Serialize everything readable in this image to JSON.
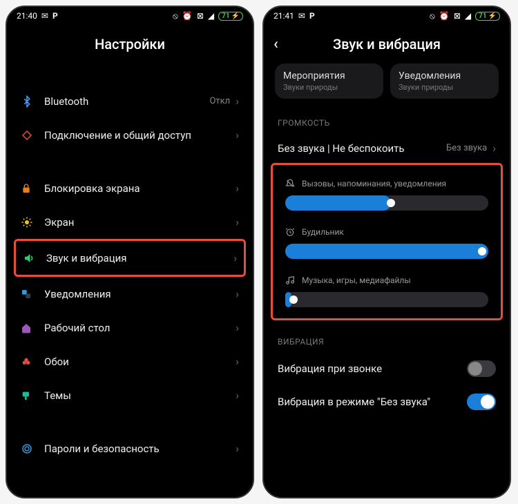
{
  "screen1": {
    "time": "21:40",
    "battery": "71",
    "header": "Настройки",
    "items": {
      "bluetooth": {
        "label": "Bluetooth",
        "value": "Откл"
      },
      "share": {
        "label": "Подключение и общий доступ"
      },
      "lock": {
        "label": "Блокировка экрана"
      },
      "display": {
        "label": "Экран"
      },
      "sound": {
        "label": "Звук и вибрация"
      },
      "notif": {
        "label": "Уведомления"
      },
      "home": {
        "label": "Рабочий стол"
      },
      "wallpaper": {
        "label": "Обои"
      },
      "themes": {
        "label": "Темы"
      },
      "passwords": {
        "label": "Пароли и безопасность"
      }
    }
  },
  "screen2": {
    "time": "21:41",
    "battery": "71",
    "header": "Звук и вибрация",
    "cards": {
      "events": {
        "title": "Мероприятия",
        "sub": "Звуки природы"
      },
      "notif": {
        "title": "Уведомления",
        "sub": "Звуки природы"
      }
    },
    "section_volume": "ГРОМКОСТЬ",
    "silent_row": {
      "label": "Без звука | Не беспокоить",
      "value": "Без звука"
    },
    "sliders": {
      "calls": {
        "label": "Вызовы, напоминания, уведомления",
        "percent": 52
      },
      "alarm": {
        "label": "Будильник",
        "percent": 100
      },
      "media": {
        "label": "Музыка, игры, медиафайлы",
        "percent": 3
      }
    },
    "section_vibration": "ВИБРАЦИЯ",
    "vibrate_ring": {
      "label": "Вибрация при звонке",
      "on": false
    },
    "vibrate_silent": {
      "label": "Вибрация в режиме \"Без звука\"",
      "on": true
    }
  }
}
